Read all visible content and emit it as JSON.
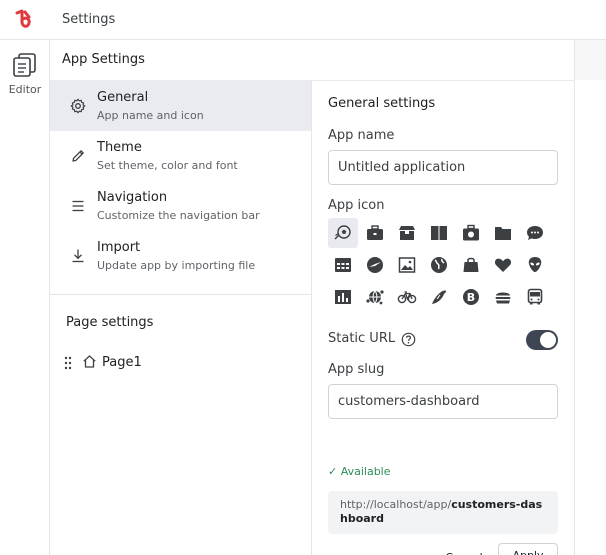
{
  "topbar": {
    "title": "Settings"
  },
  "rail": {
    "editor_label": "Editor"
  },
  "panel": {
    "header": "App Settings"
  },
  "app_settings": {
    "items": [
      {
        "title": "General",
        "subtitle": "App name and icon"
      },
      {
        "title": "Theme",
        "subtitle": "Set theme, color and font"
      },
      {
        "title": "Navigation",
        "subtitle": "Customize the navigation bar"
      },
      {
        "title": "Import",
        "subtitle": "Update app by importing file"
      }
    ]
  },
  "page_settings": {
    "title": "Page settings",
    "pages": [
      "Page1"
    ]
  },
  "general": {
    "title": "General settings",
    "app_name_label": "App name",
    "app_name_value": "Untitled application",
    "app_icon_label": "App icon",
    "icons": [
      "soccer-ball-icon",
      "toolbox-icon",
      "archive-box-icon",
      "book-open-icon",
      "camera-bag-icon",
      "folder-icon",
      "chat-bubble-icon",
      "calendar-icon",
      "compass-icon",
      "image-icon",
      "globe-icon",
      "shopping-bag-icon",
      "heart-icon",
      "alien-icon",
      "bar-chart-icon",
      "network-globe-icon",
      "bicycle-icon",
      "bird-icon",
      "bitcoin-icon",
      "burger-icon",
      "bus-icon"
    ],
    "static_url_label": "Static URL",
    "app_slug_label": "App slug",
    "app_slug_value": "customers-dashboard",
    "available_text": "✓ Available",
    "url_prefix": "http://localhost/app/",
    "url_slug": "customers-dashboard",
    "cancel_label": "Cancel",
    "apply_label": "Apply"
  },
  "colors": {
    "brand": "#e0393e",
    "toggle_on": "#3d4652",
    "available": "#2e8b57",
    "active_item": "#e9ebf1"
  }
}
